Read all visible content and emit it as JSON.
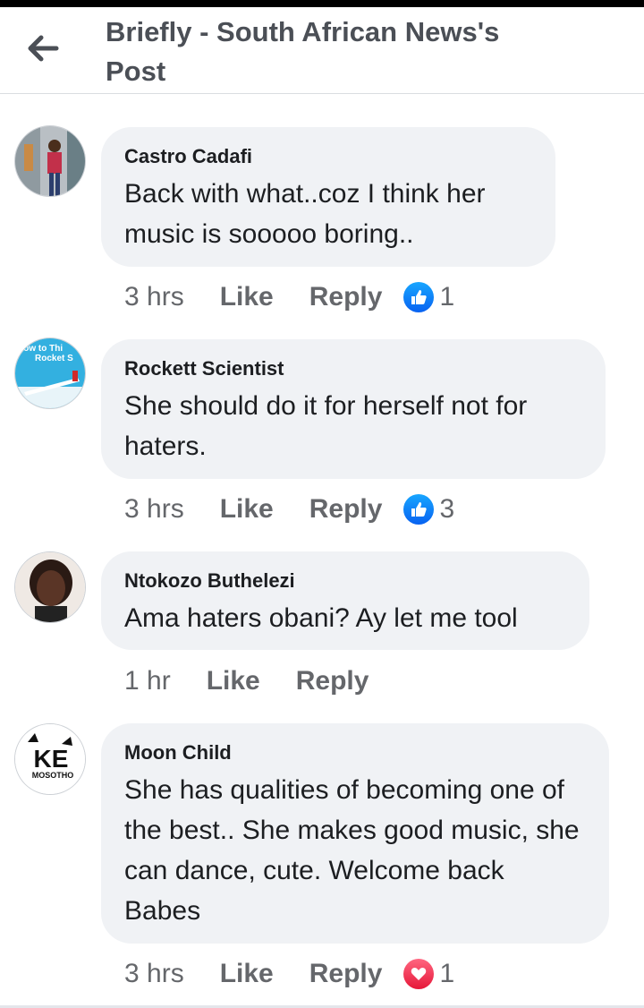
{
  "header": {
    "title": "Briefly - South African News's Post"
  },
  "comments": [
    {
      "author": "Castro Cadafi",
      "text": "Back with what..coz I think her music is sooooo boring..",
      "time": "3 hrs",
      "like_label": "Like",
      "reply_label": "Reply",
      "reaction": "like-icon",
      "reaction_count": "1"
    },
    {
      "author": "Rockett Scientist",
      "text": "She should do it for herself not for haters.",
      "time": "3 hrs",
      "like_label": "Like",
      "reply_label": "Reply",
      "reaction": "like-icon",
      "reaction_count": "3",
      "avatar_text": "How to Think Rocket S"
    },
    {
      "author": "Ntokozo Buthelezi",
      "text": "Ama haters obani? Ay let me tool",
      "time": "1 hr",
      "like_label": "Like",
      "reply_label": "Reply"
    },
    {
      "author": "Moon Child",
      "text": "She has qualities of becoming one of the best.. She makes good music, she can dance, cute. Welcome back Babes",
      "time": "3 hrs",
      "like_label": "Like",
      "reply_label": "Reply",
      "reaction": "love-icon",
      "reaction_count": "1",
      "avatar_text_main": "KE",
      "avatar_text_sub": "MOSOTHO"
    }
  ],
  "colors": {
    "like": "#1877f2",
    "love": "#f33e58",
    "bubble": "#f0f2f5",
    "meta": "#65676b"
  }
}
